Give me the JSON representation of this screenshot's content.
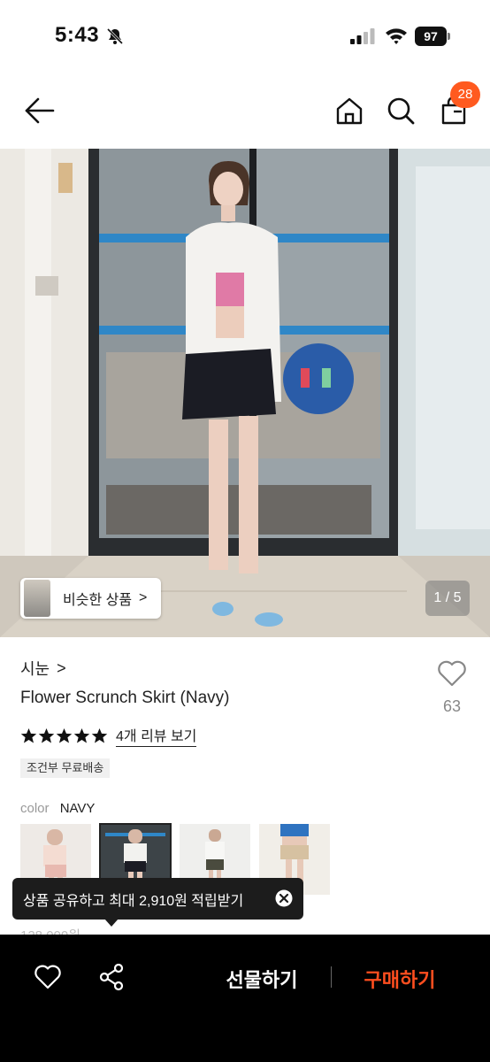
{
  "status_bar": {
    "time": "5:43",
    "battery": "97",
    "icons": [
      "bell-slash-icon",
      "signal-icon",
      "wifi-icon",
      "battery-icon"
    ]
  },
  "header": {
    "icons": [
      "back-arrow-icon",
      "home-icon",
      "search-icon",
      "shopping-bag-icon"
    ],
    "cart_count": "28"
  },
  "gallery": {
    "similar_button_label": "비슷한 상품",
    "similar_button_chevron": ">",
    "counter": "1 / 5",
    "current_index": 1,
    "total": 5
  },
  "product": {
    "brand": "시눈",
    "brand_chevron": ">",
    "name": "Flower Scrunch Skirt (Navy)",
    "like_count": "63",
    "rating_stars": 5,
    "review_link": "4개 리뷰 보기",
    "shipping_tag": "조건부 무료배송",
    "color_label": "color",
    "color_value": "NAVY",
    "swatch_count": 4,
    "selected_swatch": 1,
    "price_peek": "128,000원"
  },
  "toast": {
    "message": "상품 공유하고 최대 2,910원 적립받기"
  },
  "bottom_bar": {
    "gift_label": "선물하기",
    "buy_label": "구매하기"
  },
  "colors": {
    "accent": "#ff5a1f",
    "buy_text": "#ff4e1f",
    "bottom_bar_bg": "#000000",
    "toast_bg": "#1c1c1c"
  }
}
